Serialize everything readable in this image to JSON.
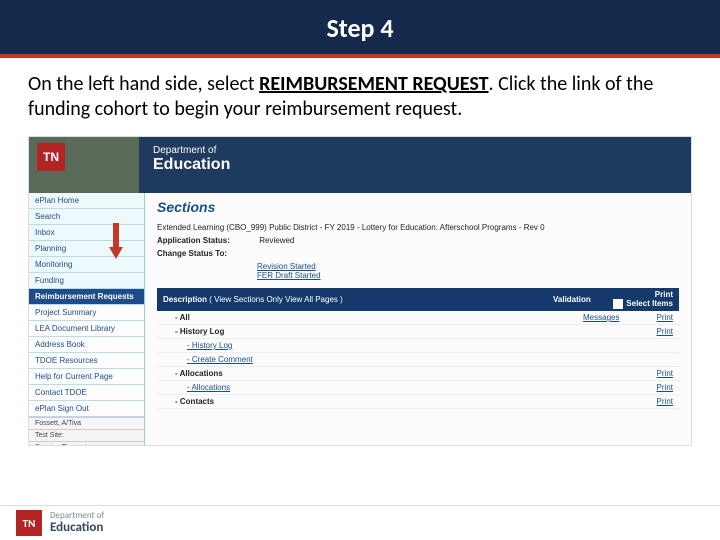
{
  "header": {
    "title": "Step 4"
  },
  "instruction": {
    "pre": "On the left hand side, select ",
    "bold": "REIMBURSEMENT REQUEST",
    "post": ". Click the link of the funding cohort to begin your reimbursement request."
  },
  "screenshot": {
    "branding": {
      "line1": "Department of",
      "line2": "Education",
      "tn": "TN"
    },
    "sidebar": {
      "items": [
        {
          "label": "ePlan Home",
          "cls": "light"
        },
        {
          "label": "Search",
          "cls": "light"
        },
        {
          "label": "Inbox",
          "cls": "light"
        },
        {
          "label": "Planning",
          "cls": "light"
        },
        {
          "label": "Monitoring",
          "cls": "light"
        },
        {
          "label": "Funding",
          "cls": "light"
        },
        {
          "label": "Reimbursement Requests",
          "cls": "active"
        },
        {
          "label": "Project Summary",
          "cls": "pale"
        },
        {
          "label": "LEA Document Library",
          "cls": "pale"
        },
        {
          "label": "Address Book",
          "cls": "pale"
        },
        {
          "label": "TDOE Resources",
          "cls": "pale"
        },
        {
          "label": "Help for Current Page",
          "cls": "pale"
        },
        {
          "label": "Contact TDOE",
          "cls": "pale"
        },
        {
          "label": "ePlan Sign Out",
          "cls": "pale"
        }
      ],
      "footer_user": "Fossett, A/Tiva",
      "footer_test": "Test Site:",
      "footer_timeout": "Session Timeout"
    },
    "main": {
      "heading": "Sections",
      "context": "Extended Learning (CBO_999) Public District - FY 2019 - Lottery for Education: Afterschool Programs - Rev 0",
      "status_label": "Application Status:",
      "status_value": "Reviewed",
      "change_label": "Change Status To:",
      "change_links": [
        "Revision Started",
        "FER Draft Started"
      ]
    },
    "table": {
      "header": {
        "desc": "Description",
        "hint": "( View Sections Only  View All Pages )",
        "val": "Validation",
        "print": "Print",
        "select": "Select Items"
      },
      "rows": [
        {
          "type": "group",
          "label": "All",
          "msg": "Messages",
          "prt": "Print"
        },
        {
          "type": "group",
          "label": "History Log",
          "msg": "",
          "prt": "Print"
        },
        {
          "type": "link",
          "indent": 2,
          "label": "History Log",
          "msg": "",
          "prt": ""
        },
        {
          "type": "link",
          "indent": 2,
          "label": "Create Comment",
          "msg": "",
          "prt": ""
        },
        {
          "type": "group",
          "label": "Allocations",
          "msg": "",
          "prt": "Print"
        },
        {
          "type": "link",
          "indent": 2,
          "label": "Allocations",
          "msg": "",
          "prt": "Print"
        },
        {
          "type": "group",
          "label": "Contacts",
          "msg": "",
          "prt": "Print"
        }
      ]
    }
  },
  "footer": {
    "tn": "TN",
    "line1": "Department of",
    "line2": "Education"
  }
}
